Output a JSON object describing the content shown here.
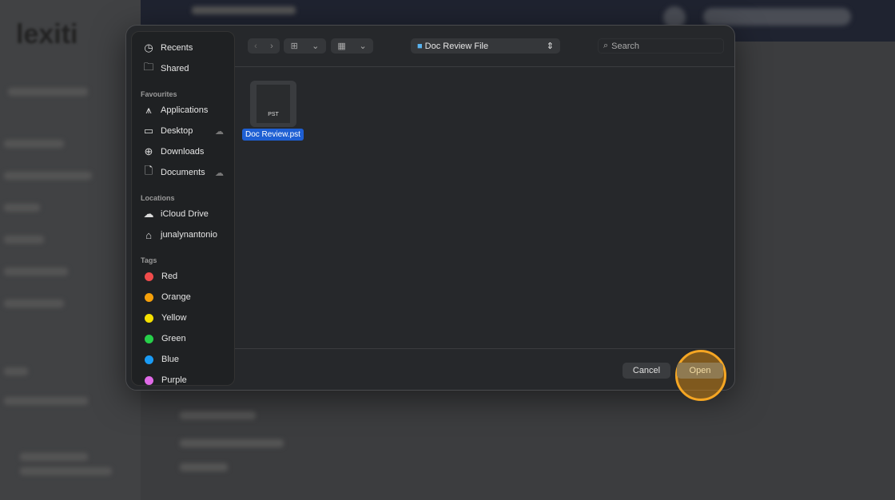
{
  "background": {
    "logo": "lexiti"
  },
  "dialog": {
    "sidebar": {
      "top": [
        {
          "label": "Recents",
          "icon": "clock-icon"
        },
        {
          "label": "Shared",
          "icon": "shared-folder-icon"
        }
      ],
      "favourites_header": "Favourites",
      "favourites": [
        {
          "label": "Applications",
          "icon": "applications-icon"
        },
        {
          "label": "Desktop",
          "icon": "desktop-icon",
          "cloud": true
        },
        {
          "label": "Downloads",
          "icon": "download-icon"
        },
        {
          "label": "Documents",
          "icon": "document-icon",
          "cloud": true
        }
      ],
      "locations_header": "Locations",
      "locations": [
        {
          "label": "iCloud Drive",
          "icon": "cloud-icon"
        },
        {
          "label": "junalynantonio",
          "icon": "home-icon"
        }
      ],
      "tags_header": "Tags",
      "tags": [
        {
          "label": "Red",
          "color": "#f04b4b"
        },
        {
          "label": "Orange",
          "color": "#f5a00a"
        },
        {
          "label": "Yellow",
          "color": "#f5e000"
        },
        {
          "label": "Green",
          "color": "#27d04a"
        },
        {
          "label": "Blue",
          "color": "#1a9bf5"
        },
        {
          "label": "Purple",
          "color": "#e06ae8"
        }
      ]
    },
    "toolbar": {
      "location": "Doc Review File",
      "search_placeholder": "Search"
    },
    "files": [
      {
        "name": "Doc Review.pst",
        "type_label": "PST",
        "selected": true
      }
    ],
    "footer": {
      "cancel": "Cancel",
      "open": "Open"
    },
    "highlight_color": "#f5a623"
  }
}
